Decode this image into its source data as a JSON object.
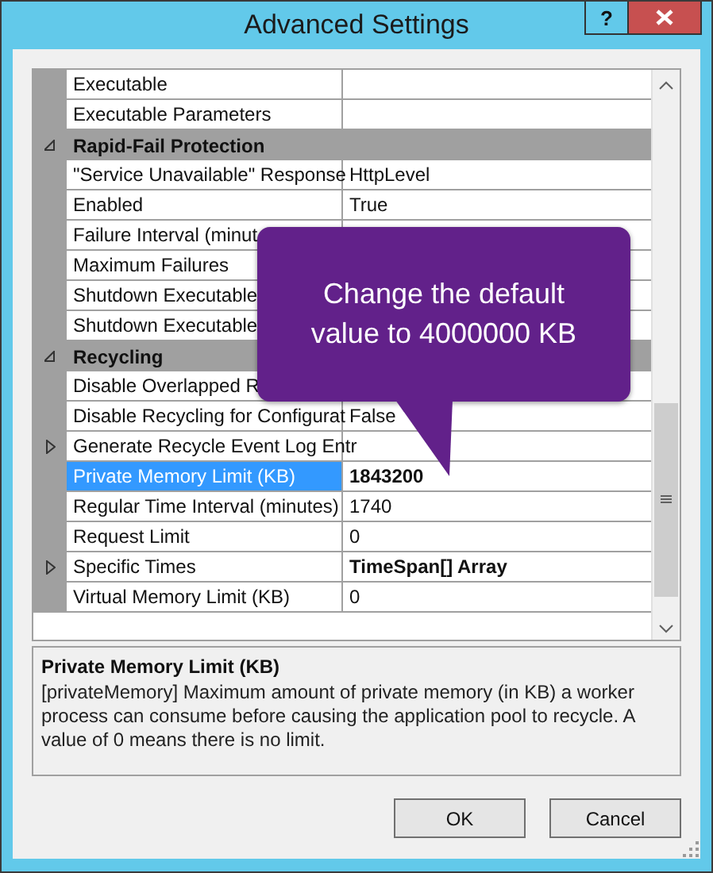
{
  "window": {
    "title": "Advanced Settings",
    "help_button": "?"
  },
  "grid": {
    "rows": [
      {
        "kind": "property",
        "name": "Executable",
        "selected": false
      },
      {
        "kind": "property",
        "name": "Executable Parameters",
        "selected": false
      },
      {
        "kind": "category",
        "name": "Rapid-Fail Protection",
        "expanded": true
      },
      {
        "kind": "property",
        "name": "\"Service Unavailable\" Response",
        "value": "HttpLevel",
        "selected": false,
        "modified": false
      },
      {
        "kind": "property",
        "name": "Enabled",
        "value": "True",
        "selected": false,
        "modified": false
      },
      {
        "kind": "property",
        "name": "Failure Interval (minut",
        "selected": false
      },
      {
        "kind": "property",
        "name": "Maximum Failures",
        "selected": false
      },
      {
        "kind": "property",
        "name": "Shutdown Executable",
        "selected": false
      },
      {
        "kind": "property",
        "name": "Shutdown Executable",
        "selected": false
      },
      {
        "kind": "category",
        "name": "Recycling",
        "expanded": true
      },
      {
        "kind": "property",
        "name": "Disable Overlapped R",
        "selected": false
      },
      {
        "kind": "property",
        "name": "Disable Recycling for Configurat",
        "value": "False",
        "selected": false,
        "modified": false
      },
      {
        "kind": "collection",
        "name": "Generate Recycle Event Log Entr",
        "selected": false
      },
      {
        "kind": "property",
        "name": "Private Memory Limit (KB)",
        "value": "1843200",
        "selected": true,
        "modified": true
      },
      {
        "kind": "property",
        "name": "Regular Time Interval (minutes)",
        "value": "1740",
        "selected": false,
        "modified": false
      },
      {
        "kind": "property",
        "name": "Request Limit",
        "value": "0",
        "selected": false,
        "modified": false
      },
      {
        "kind": "collection",
        "name": "Specific Times",
        "value": "TimeSpan[] Array",
        "selected": false,
        "modified": true
      },
      {
        "kind": "property",
        "name": "Virtual Memory Limit (KB)",
        "value": "0",
        "selected": false,
        "modified": false
      }
    ]
  },
  "callout": {
    "text": "Change the default value to 4000000 KB"
  },
  "description": {
    "title": "Private Memory Limit (KB)",
    "text": "[privateMemory] Maximum amount of private memory (in KB) a worker process can consume before causing the application pool to recycle.  A value of 0 means there is no limit."
  },
  "buttons": [
    "OK",
    "Cancel"
  ]
}
